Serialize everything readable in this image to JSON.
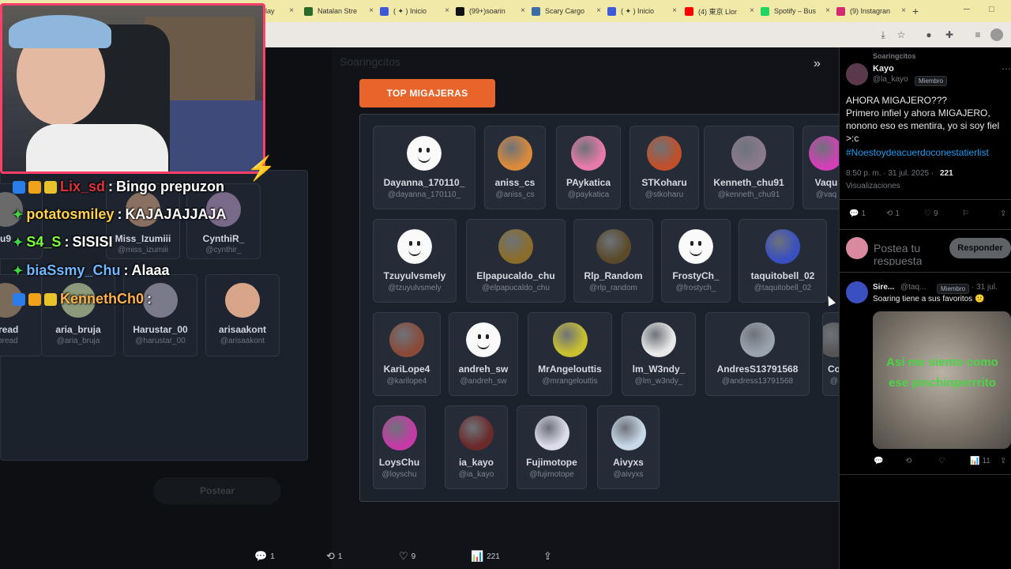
{
  "browser": {
    "tabs": [
      {
        "label": "lay",
        "color": "#d93025"
      },
      {
        "label": "Natalan Stre",
        "color": "#2a6a2a"
      },
      {
        "label": "( ✦ ) Inicio",
        "color": "#3b5bdb"
      },
      {
        "label": "(99+)soarin",
        "color": "#111111"
      },
      {
        "label": "Scary Cargo",
        "color": "#3a6ea5"
      },
      {
        "label": "( ✦ ) Inicio",
        "color": "#3b5bdb"
      },
      {
        "label": "(4) 東京 Llor",
        "color": "#ff0000"
      },
      {
        "label": "Spotify – Bus",
        "color": "#1ed760"
      },
      {
        "label": "(9) Instagran",
        "color": "#d62976"
      }
    ],
    "tab_close": "×",
    "new_tab": "+",
    "minimize": "─",
    "maximize": "□"
  },
  "page": {
    "blurred_header": "Soaringcitos",
    "top_button_label": "TOP MIGAJERAS",
    "expand_icon": "»",
    "post_button": "Postear",
    "grid_rows": [
      [
        {
          "name": "Dayanna_170110_",
          "handle": "@dayanna_170110_",
          "avatar": "smiley"
        },
        {
          "name": "aniss_cs",
          "handle": "@aniss_cs",
          "avatar": "#d98a3a"
        },
        {
          "name": "PAykatica",
          "handle": "@paykatica",
          "avatar": "#e67aa8"
        },
        {
          "name": "STKoharu",
          "handle": "@stkoharu",
          "avatar": "#c0502a"
        },
        {
          "name": "Kenneth_chu91",
          "handle": "@kenneth_chu91",
          "avatar": "#8a7a8c"
        },
        {
          "name": "Vaqu",
          "handle": "@vaq",
          "avatar": "#d43fb8"
        }
      ],
      [
        {
          "name": "Tzuyulvsmely",
          "handle": "@tzuyulvsmely",
          "avatar": "smiley"
        },
        {
          "name": "Elpapucaldo_chu",
          "handle": "@elpapucaldo_chu",
          "avatar": "#8a6d2a"
        },
        {
          "name": "Rlp_Random",
          "handle": "@rlp_random",
          "avatar": "#5a4a2a"
        },
        {
          "name": "FrostyCh_",
          "handle": "@frostych_",
          "avatar": "smiley"
        },
        {
          "name": "taquitobell_02",
          "handle": "@taquitobell_02",
          "avatar": "#3a4fc0"
        }
      ],
      [
        {
          "name": "KariLope4",
          "handle": "@karilope4",
          "avatar": "#8a4a3a"
        },
        {
          "name": "andreh_sw",
          "handle": "@andreh_sw",
          "avatar": "smiley"
        },
        {
          "name": "MrAngelouttis",
          "handle": "@mrangelouttis",
          "avatar": "#c8c030"
        },
        {
          "name": "lm_W3ndy_",
          "handle": "@lm_w3ndy_",
          "avatar": "#e8e8e8"
        },
        {
          "name": "AndresS13791568",
          "handle": "@andress13791568",
          "avatar": "#9aa4ae"
        },
        {
          "name": "Co",
          "handle": "@",
          "avatar": "#555555"
        }
      ],
      [
        {
          "name": "LoysChu",
          "handle": "@loyschu",
          "avatar": "#c43ba6"
        },
        {
          "name": "ia_kayo",
          "handle": "@ia_kayo",
          "avatar": "#6a2a2a"
        },
        {
          "name": "Fujimotope",
          "handle": "@fujimotope",
          "avatar": "#dcdcea"
        },
        {
          "name": "Aivyxs",
          "handle": "@aivyxs",
          "avatar": "#c8d8e8"
        }
      ]
    ],
    "left_cards": [
      {
        "name": "bread",
        "handle": "ebread"
      },
      {
        "name": "aria_bruja",
        "handle": "@aria_bruja"
      },
      {
        "name": "Harustar_00",
        "handle": "@harustar_00"
      },
      {
        "name": "arisaakont",
        "handle": "@arisaakont"
      },
      {
        "name": "u9",
        "handle": ""
      },
      {
        "name": "Miss_Izumiii",
        "handle": "@miss_izumiii"
      },
      {
        "name": "CynthiR_",
        "handle": "@cynthir_"
      }
    ],
    "bottom_actions": {
      "replies": "1",
      "reposts": "1",
      "likes": "9",
      "views": "221",
      "reply_icon": "💬",
      "repost_icon": "⟲",
      "like_icon": "♡",
      "views_icon": "📊",
      "share_icon": "⇪"
    }
  },
  "sidebar": {
    "community": "Soaringcitos",
    "author": "Kayo",
    "handle": "@la_kayo",
    "badge": "Miembro",
    "tweet_lines": [
      "AHORA MIGAJERO???",
      "Primero infiel y ahora MIGAJERO,",
      "nonono eso es mentira, yo si soy fiel",
      ">:c"
    ],
    "hashtag": "#Noestoydeacuerdoconestatierlist",
    "time": "8:50 p. m. · 31 jul. 2025 ·",
    "views_count": "221",
    "views_label": "Visualizaciones",
    "actions": {
      "replies": "1",
      "reposts": "1",
      "likes": "9"
    },
    "reply_placeholder_1": "Postea tu",
    "reply_placeholder_2": "respuesta",
    "reply_button": "Responder",
    "reply_author": "Sire...",
    "reply_handle": "@taq...",
    "reply_badge": "Miembro",
    "reply_date": "· 31 jul.",
    "reply_text": "Soaring tiene a sus favoritos 😕",
    "meme_text": "Asi me siento como ese pinchinperrrito",
    "reply_actions": {
      "views": "11"
    }
  },
  "chat": [
    {
      "user": "Lix_sd",
      "message": "Bingo prepuzon",
      "color": "#e0303a",
      "badges": true
    },
    {
      "user": "potatosmiley",
      "message": "KAJAJAJJAJA",
      "color": "#ffd24a",
      "badges": false
    },
    {
      "user": "S4_S",
      "message": "SISISI",
      "color": "#7cff3a",
      "badges": false
    },
    {
      "user": "biaSsmy_Chu",
      "message": "Alaaa",
      "color": "#6fb7ff",
      "badges": false
    },
    {
      "user": "KennethCh0",
      "message": "",
      "color": "#ffb14a",
      "badges": true
    }
  ],
  "colors": {
    "accent_orange": "#e8642b",
    "webcam_border": "#ff3f67",
    "tabbar": "#f1e9a7"
  }
}
